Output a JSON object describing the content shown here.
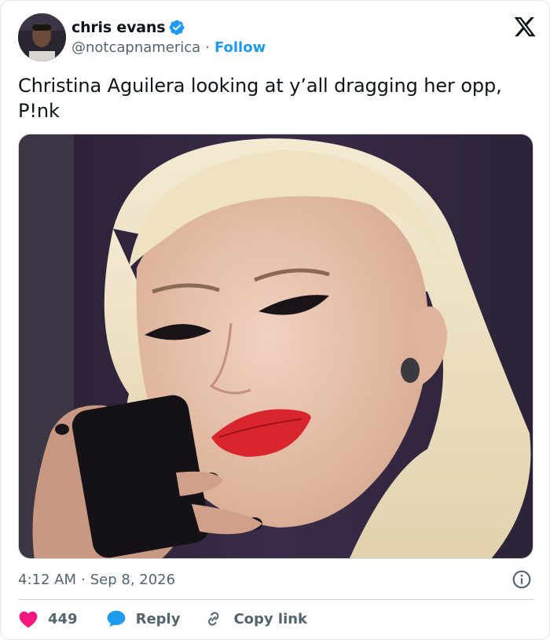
{
  "author": {
    "name": "chris evans",
    "handle": "@notcapnamerica",
    "separator": "·",
    "follow_label": "Follow"
  },
  "tweet": {
    "text": "Christina Aguilera looking at y’all dragging her opp, P!nk"
  },
  "meta": {
    "time": "4:12 AM",
    "separator": "·",
    "date": "Sep 8, 2026"
  },
  "actions": {
    "likes": "449",
    "reply_label": "Reply",
    "copy_label": "Copy link"
  },
  "colors": {
    "accent": "#1d9bf0",
    "like": "#f91880",
    "secondary_text": "#536471",
    "divider": "#cfd9de"
  },
  "icons": {
    "verified": "verified-badge-icon",
    "logo": "x-logo-icon",
    "info": "info-icon",
    "like": "heart-icon",
    "reply": "speech-bubble-icon",
    "copy": "link-icon"
  }
}
